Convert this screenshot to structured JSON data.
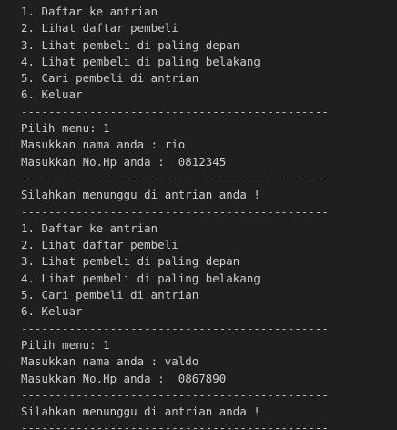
{
  "terminal": {
    "top_cutoff": "~~~~~~~~~~~~~~~~~~~~~~~~~~~~~~~~~~~~~~~~~~~~~~",
    "lines": [
      "1. Daftar ke antrian",
      "2. Lihat daftar pembeli",
      "3. Lihat pembeli di paling depan",
      "4. Lihat pembeli di paling belakang",
      "5. Cari pembeli di antrian",
      "6. Keluar",
      "---------------------------------------------",
      "Pilih menu: 1",
      "Masukkan nama anda : rio",
      "Masukkan No.Hp anda :  0812345",
      "---------------------------------------------",
      "Silahkan menunggu di antrian anda !",
      "---------------------------------------------",
      "1. Daftar ke antrian",
      "2. Lihat daftar pembeli",
      "3. Lihat pembeli di paling depan",
      "4. Lihat pembeli di paling belakang",
      "5. Cari pembeli di antrian",
      "6. Keluar",
      "---------------------------------------------",
      "Pilih menu: 1",
      "Masukkan nama anda : valdo",
      "Masukkan No.Hp anda :  0867890",
      "---------------------------------------------",
      "Silahkan menunggu di antrian anda !",
      "---------------------------------------------"
    ]
  }
}
